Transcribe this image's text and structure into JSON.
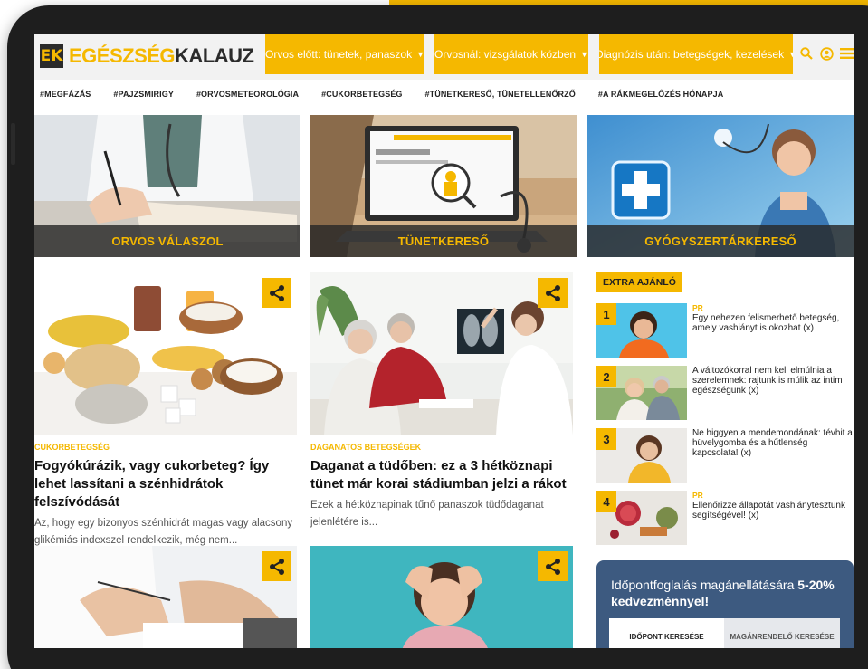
{
  "site": {
    "logo_mark": "EK",
    "logo_part_a": "EGÉSZSÉG",
    "logo_part_b": "KALAUZ"
  },
  "nav": [
    {
      "label": "Orvos előtt: tünetek, panaszok"
    },
    {
      "label": "Orvosnál: vizsgálatok közben"
    },
    {
      "label": "Diagnózis után: betegségek, kezelések"
    }
  ],
  "header_icons": [
    "search-icon",
    "user-icon",
    "menu-icon"
  ],
  "hashtags": [
    "#MEGFÁZÁS",
    "#PAJZSMIRIGY",
    "#ORVOSMETEOROLÓGIA",
    "#CUKORBETEGSÉG",
    "#TÜNETKERESŐ, TÜNETELLENŐRZŐ",
    "#A RÁKMEGELŐZÉS HÓNAPJA"
  ],
  "hero_tiles": [
    {
      "label": "ORVOS VÁLASZOL"
    },
    {
      "label": "TÜNETKERESŐ"
    },
    {
      "label": "GYÓGYSZERTÁRKERESŐ"
    }
  ],
  "articles": [
    {
      "category": "CUKORBETEGSÉG",
      "title": "Fogyókúrázik, vagy cukorbeteg? Így lehet lassítani a szénhidrátok felszívódását",
      "excerpt": "Az, hogy egy bizonyos szénhidrát magas vagy alacsony glikémiás indexszel rendelkezik, még nem..."
    },
    {
      "category": "DAGANATOS BETEGSÉGEK",
      "title": "Daganat a tüdőben: ez a 3 hétköznapi tünet már korai stádiumban jelzi a rákot",
      "excerpt": "Ezek a hétköznapinak tűnő panaszok tüdődaganat jelenlétére is..."
    }
  ],
  "extra": {
    "heading": "EXTRA AJÁNLÓ",
    "items": [
      {
        "num": "1",
        "pr": "PR",
        "title": "Egy nehezen felismerhető betegség, amely vashiányt is okozhat (x)"
      },
      {
        "num": "2",
        "pr": "",
        "title": "A változókorral nem kell elmúlnia a szerelemnek: rajtunk is múlik az intim egészségünk (x)"
      },
      {
        "num": "3",
        "pr": "",
        "title": "Ne higgyen a mendemondának: tévhit a hüvelygomba és a hűtlenség kapcsolata! (x)"
      },
      {
        "num": "4",
        "pr": "PR",
        "title": "Ellenőrizze állapotát vashiánytesztünk segítségével! (x)"
      }
    ]
  },
  "booking": {
    "title_plain": "Időpontfoglalás magánellátására ",
    "title_bold": "5-20% kedvezménnyel!",
    "tab_active": "IDŐPONT KERESÉSE",
    "tab_inactive": "MAGÁNRENDELŐ KERESÉSE"
  },
  "colors": {
    "accent": "#f5b800",
    "dark": "#2b2b2b",
    "booking_bg": "#3d5a80"
  }
}
